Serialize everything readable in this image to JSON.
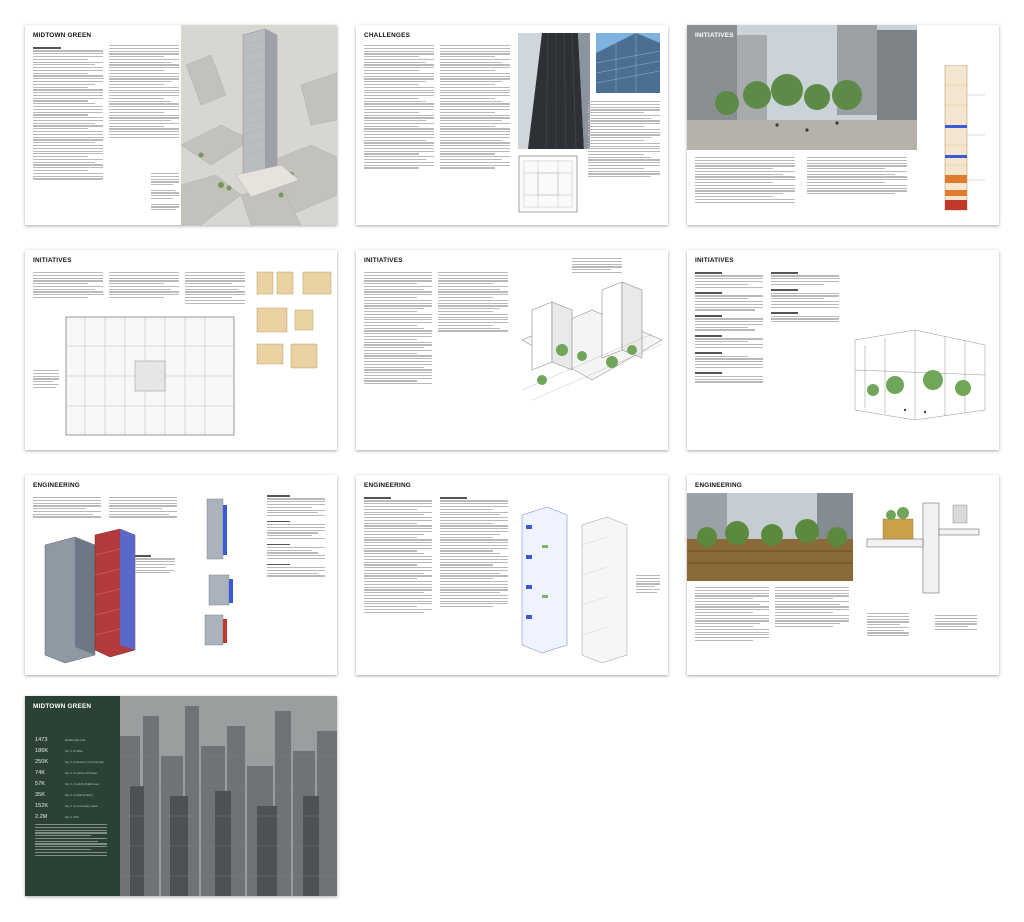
{
  "spreads": [
    {
      "title": "MIDTOWN GREEN",
      "tag": ""
    },
    {
      "title": "CHALLENGES",
      "tag": ""
    },
    {
      "title": "INITIATIVES",
      "tag": ""
    },
    {
      "title": "INITIATIVES",
      "tag": ""
    },
    {
      "title": "INITIATIVES",
      "tag": ""
    },
    {
      "title": "INITIATIVES",
      "tag": ""
    },
    {
      "title": "ENGINEERING",
      "tag": ""
    },
    {
      "title": "ENGINEERING",
      "tag": ""
    },
    {
      "title": "ENGINEERING",
      "tag": ""
    }
  ],
  "summary": {
    "title": "MIDTOWN GREEN",
    "stats": [
      {
        "value": "1473",
        "label": "Residential units"
      },
      {
        "value": "186K",
        "label": "Sq. ft. of office"
      },
      {
        "value": "250K",
        "label": "Sq. ft. of amenity (Commercial)"
      },
      {
        "value": "74K",
        "label": "Sq. ft. of outdoor (Private)"
      },
      {
        "value": "57K",
        "label": "Sq. ft. of public (Public use)"
      },
      {
        "value": "35K",
        "label": "Sq. ft. of retail (Public)"
      },
      {
        "value": "152K",
        "label": "Sq. ft. of community space"
      },
      {
        "value": "2.2M",
        "label": "Sq. ft. GFA"
      }
    ]
  },
  "colors": {
    "panel_green": "#1c3428",
    "accent_orange": "#e07a2c",
    "accent_red": "#c0392b",
    "accent_blue": "#3b5bd6",
    "plan_tan": "#c9a14a"
  }
}
